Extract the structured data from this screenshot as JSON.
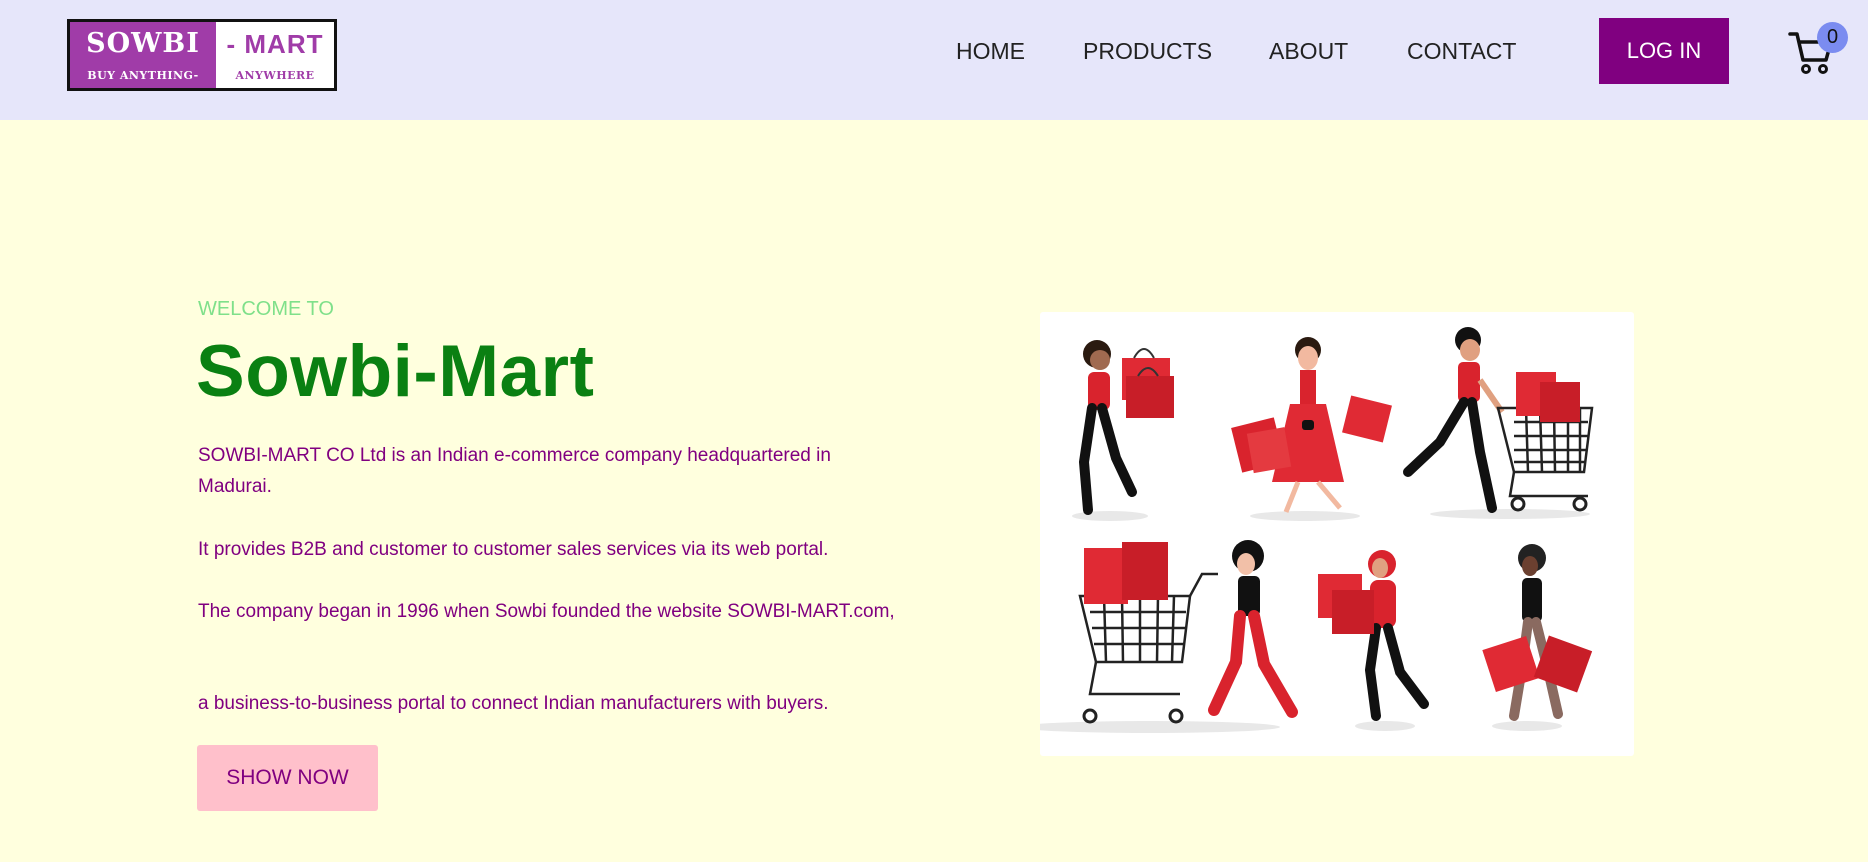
{
  "header": {
    "logo": {
      "left_text": "SOWBI",
      "left_tagline": "BUY ANYTHING-",
      "right_text": "- MART",
      "right_tagline": "ANYWHERE"
    },
    "nav": [
      {
        "label": "HOME"
      },
      {
        "label": "PRODUCTS"
      },
      {
        "label": "ABOUT"
      },
      {
        "label": "CONTACT"
      }
    ],
    "login_label": "LOG IN",
    "cart_count": "0"
  },
  "hero": {
    "welcome": "WELCOME TO",
    "title": "Sowbi-Mart",
    "paragraphs": [
      "SOWBI-MART CO Ltd is an Indian e-commerce company headquartered in Madurai.",
      "It provides B2B and customer to customer sales services via its web portal.",
      "The company began in 1996 when Sowbi founded the website SOWBI-MART.com,",
      "a business-to-business portal to connect Indian manufacturers with buyers."
    ],
    "button_label": "SHOW NOW"
  },
  "colors": {
    "header_bg": "#e6e6fa",
    "page_bg": "#ffffde",
    "brand_purple": "#800080",
    "title_green": "#0a8012",
    "welcome_green": "#7fe08a",
    "button_pink": "#ffc0cb",
    "badge_blue": "#7b8cf0"
  }
}
